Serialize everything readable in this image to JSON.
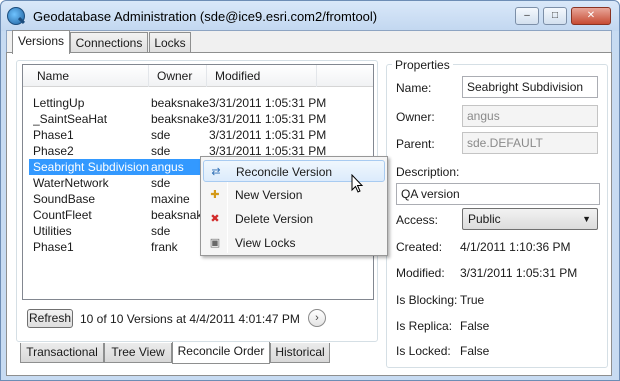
{
  "window": {
    "title": "Geodatabase Administration (sde@ice9.esri.com2/fromtool)"
  },
  "caption_buttons": {
    "minimize": "–",
    "maximize": "□",
    "close": "✕"
  },
  "tabs": [
    "Versions",
    "Connections",
    "Locks"
  ],
  "list": {
    "columns": [
      "Name",
      "Owner",
      "Modified"
    ],
    "rows": [
      {
        "name": "LettingUp",
        "owner": "beaksnake",
        "modified": "3/31/2011 1:05:31 PM"
      },
      {
        "name": "_SaintSeaHat",
        "owner": "beaksnake",
        "modified": "3/31/2011 1:05:31 PM"
      },
      {
        "name": "Phase1",
        "owner": "sde",
        "modified": "3/31/2011 1:05:31 PM"
      },
      {
        "name": "Phase2",
        "owner": "sde",
        "modified": "3/31/2011 1:05:31 PM"
      },
      {
        "name": "Seabright Subdivision",
        "owner": "angus",
        "modified": ""
      },
      {
        "name": "WaterNetwork",
        "owner": "sde",
        "modified": ""
      },
      {
        "name": "SoundBase",
        "owner": "maxine",
        "modified": ""
      },
      {
        "name": "CountFleet",
        "owner": "beaksnake",
        "modified": ""
      },
      {
        "name": "Utilities",
        "owner": "sde",
        "modified": ""
      },
      {
        "name": "Phase1",
        "owner": "frank",
        "modified": ""
      }
    ]
  },
  "context_menu": {
    "items": [
      {
        "label": "Reconcile Version",
        "icon": "reconcile-icon"
      },
      {
        "label": "New Version",
        "icon": "new-version-icon"
      },
      {
        "label": "Delete Version",
        "icon": "delete-icon"
      },
      {
        "label": "View Locks",
        "icon": "lock-icon"
      }
    ]
  },
  "footer": {
    "refresh_label": "Refresh",
    "status": "10 of 10 Versions at 4/4/2011 4:01:47 PM",
    "next_glyph": "›"
  },
  "bottom_tabs": [
    "Transactional",
    "Tree View",
    "Reconcile Order",
    "Historical"
  ],
  "properties": {
    "title": "Properties",
    "name_label": "Name:",
    "name_value": "Seabright Subdivision",
    "owner_label": "Owner:",
    "owner_value": "angus",
    "parent_label": "Parent:",
    "parent_value": "sde.DEFAULT",
    "description_label": "Description:",
    "description_value": "QA version",
    "access_label": "Access:",
    "access_value": "Public",
    "created_label": "Created:",
    "created_value": "4/1/2011 1:10:36 PM",
    "modified_label": "Modified:",
    "modified_value": "3/31/2011 1:05:31 PM",
    "blocking_label": "Is Blocking:",
    "blocking_value": "True",
    "replica_label": "Is Replica:",
    "replica_value": "False",
    "locked_label": "Is Locked:",
    "locked_value": "False"
  },
  "colors": {
    "selection": "#3399ff",
    "title_bar": "#c7dbf2",
    "menu_highlight": "#dcebfc"
  }
}
